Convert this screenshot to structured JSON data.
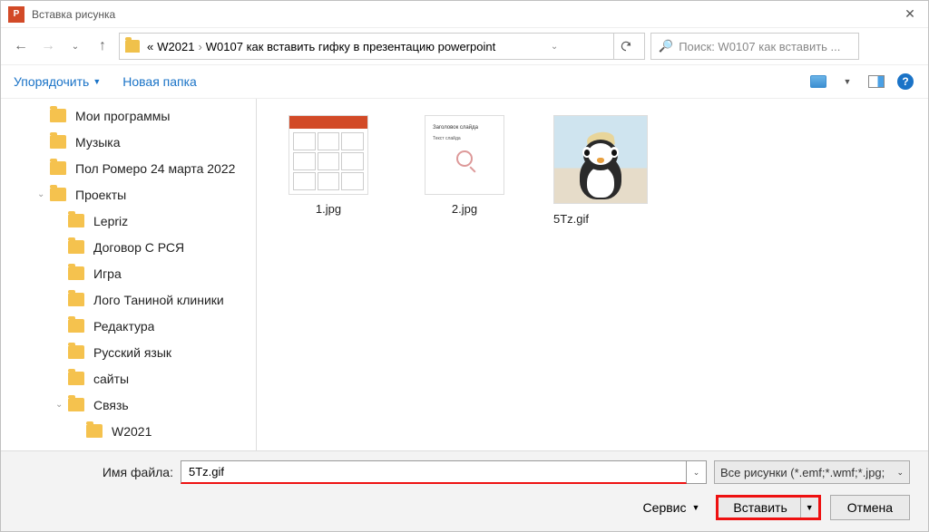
{
  "window": {
    "title": "Вставка рисунка"
  },
  "breadcrumb": {
    "prefix": "«",
    "segments": [
      "W2021",
      "W0107 как вставить гифку в презентацию powerpoint"
    ]
  },
  "search": {
    "placeholder": "Поиск: W0107 как вставить ..."
  },
  "toolbar": {
    "organize": "Упорядочить",
    "new_folder": "Новая папка"
  },
  "tree": [
    {
      "label": "Мои программы",
      "depth": 1,
      "caret": false
    },
    {
      "label": "Музыка",
      "depth": 1,
      "caret": false
    },
    {
      "label": "Пол Ромеро 24 марта 2022",
      "depth": 1,
      "caret": false
    },
    {
      "label": "Проекты",
      "depth": 1,
      "caret": true
    },
    {
      "label": "Lepriz",
      "depth": 2,
      "caret": false
    },
    {
      "label": "Договор С РСЯ",
      "depth": 2,
      "caret": false
    },
    {
      "label": "Игра",
      "depth": 2,
      "caret": false
    },
    {
      "label": "Лого Таниной клиники",
      "depth": 2,
      "caret": false
    },
    {
      "label": "Редактура",
      "depth": 2,
      "caret": false
    },
    {
      "label": "Русский язык",
      "depth": 2,
      "caret": false
    },
    {
      "label": "сайты",
      "depth": 2,
      "caret": false
    },
    {
      "label": "Связь",
      "depth": 2,
      "caret": true
    },
    {
      "label": "W2021",
      "depth": 3,
      "caret": false
    }
  ],
  "files": [
    {
      "name": "1.jpg",
      "kind": "pp",
      "selected": false
    },
    {
      "name": "2.jpg",
      "kind": "doc",
      "selected": false
    },
    {
      "name": "5Tz.gif",
      "kind": "penguin",
      "selected": true
    }
  ],
  "bottom": {
    "filename_label": "Имя файла:",
    "filename_value": "5Tz.gif",
    "filter_label": "Все рисунки (*.emf;*.wmf;*.jpg;",
    "service_label": "Сервис",
    "insert_label": "Вставить",
    "cancel_label": "Отмена"
  }
}
